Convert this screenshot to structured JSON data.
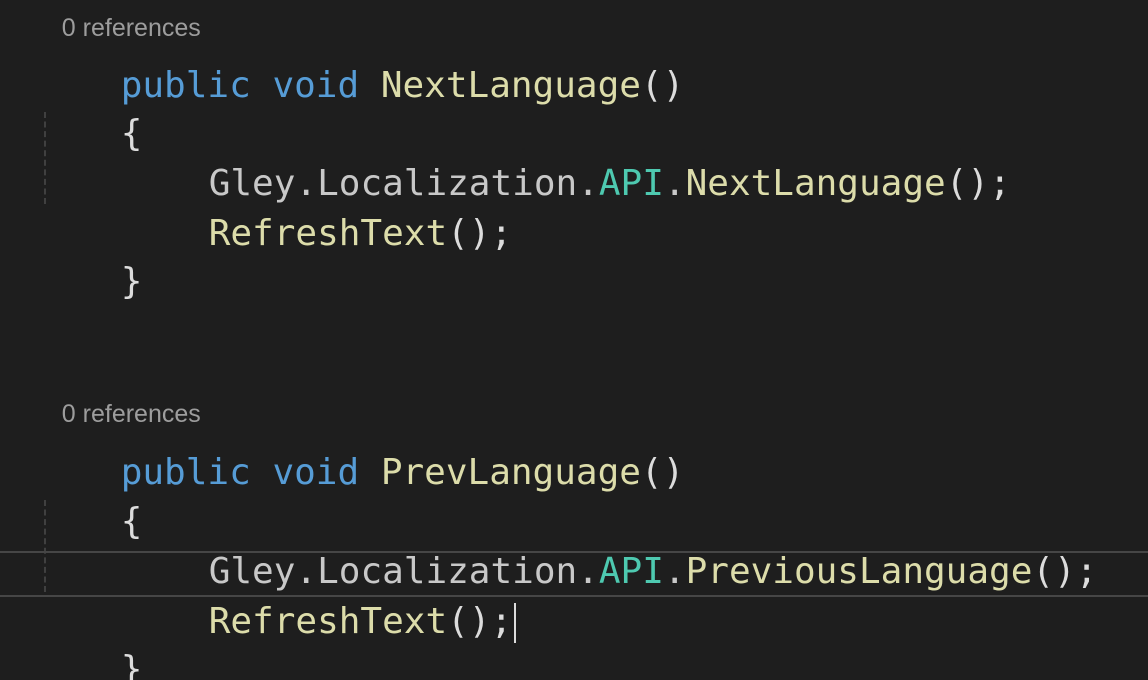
{
  "editor": {
    "refs_top_partial": "0 references",
    "method1": {
      "modifier": "public",
      "return_type": "void",
      "name": "NextLanguage",
      "params": "()",
      "open_brace": "{",
      "call_ns1": "Gley",
      "call_ns2": "Localization",
      "call_class": "API",
      "call_method": "NextLanguage",
      "call_tail": "();",
      "refresh_name": "RefreshText",
      "refresh_tail": "();",
      "close_brace": "}"
    },
    "refs_second": "0 references",
    "method2": {
      "modifier": "public",
      "return_type": "void",
      "name": "PrevLanguage",
      "params": "()",
      "open_brace": "{",
      "call_ns1": "Gley",
      "call_ns2": "Localization",
      "call_class": "API",
      "call_method": "PreviousLanguage",
      "call_tail": "();",
      "refresh_name": "RefreshText",
      "refresh_tail": "();",
      "close_brace": "}"
    },
    "dot": ".",
    "space": " "
  },
  "colors": {
    "background": "#1e1e1e",
    "keyword": "#569cd6",
    "method": "#dcdcaa",
    "class": "#4ec9b0",
    "identifier": "#c8c8c8",
    "punctuation": "#dcdcdc",
    "codelens": "#9d9d9d"
  }
}
